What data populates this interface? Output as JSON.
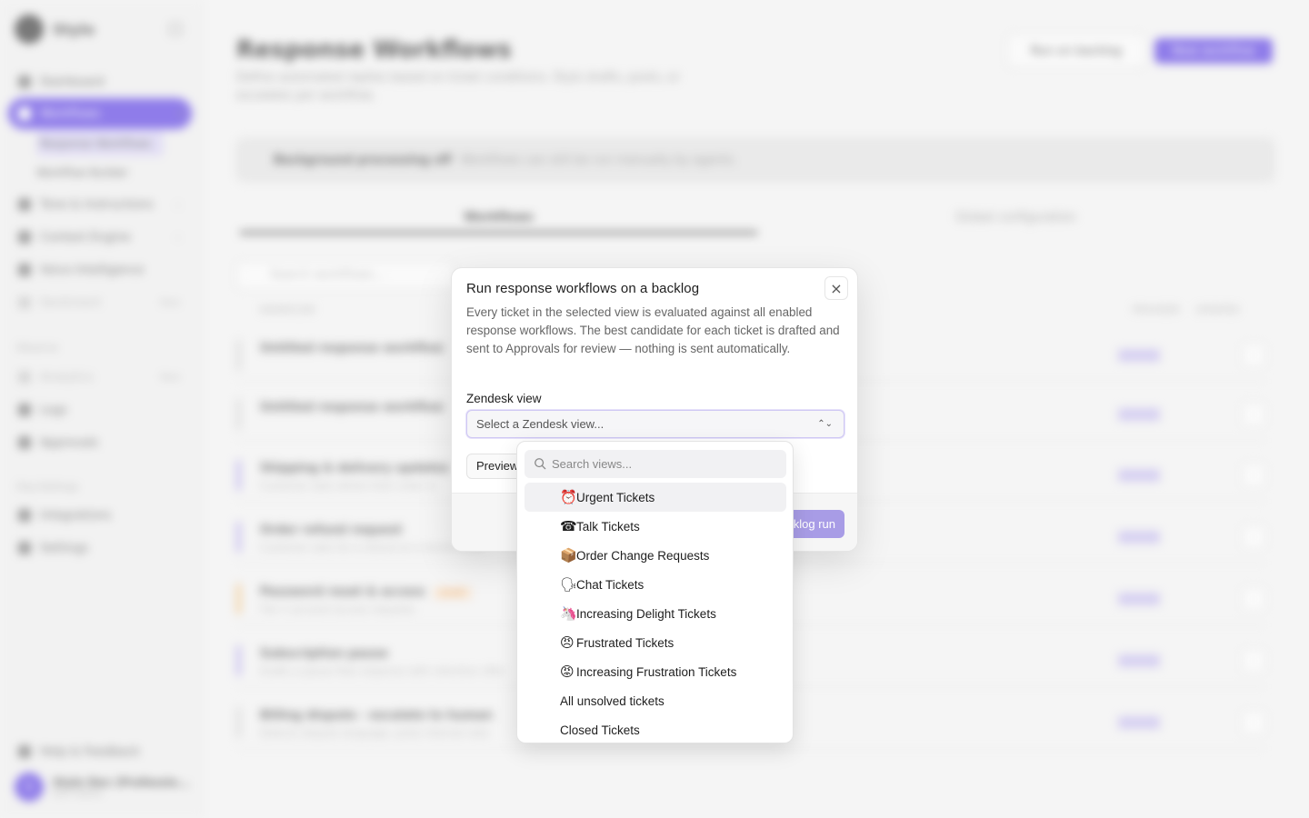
{
  "sidebar": {
    "brand": "Stylo",
    "nav": [
      {
        "label": "Dashboard"
      },
      {
        "label": "Workflows"
      },
      {
        "label": "Response Workflows"
      },
      {
        "label": "Workflow Builder"
      },
      {
        "label": "Tone & Instructions"
      },
      {
        "label": "Context Engine"
      },
      {
        "label": "Voice Intelligence"
      },
      {
        "label": "Sentiment",
        "badge": "New"
      }
    ],
    "observe_label": "Observe",
    "observe": [
      {
        "label": "Analytics",
        "badge": "New"
      },
      {
        "label": "Logs"
      },
      {
        "label": "Approvals"
      }
    ],
    "org_label": "Org Settings",
    "org": [
      {
        "label": "Integrations"
      },
      {
        "label": "Settings"
      }
    ],
    "help": "Help & Feedback",
    "user": {
      "initial": "S",
      "name": "Stylo Dev (Professio...",
      "sub": "Dev Owner"
    }
  },
  "main": {
    "title": "Response Workflows",
    "description": "Define automated replies based on ticket conditions. Stylo drafts, posts, or escalates per workflow.",
    "run_backlog": "Run on backlog",
    "new_workflow": "New workflow",
    "banner_title": "Background processing off",
    "banner_text": "Workflows can still be run manually by agents.",
    "tabs": [
      "Workflows",
      "Global configuration"
    ],
    "search_placeholder": "Search workflows...",
    "columns": [
      "WORKFLOW",
      "PROVIDER",
      "UPDATED"
    ],
    "rows": [
      {
        "title": "Untitled response workflow",
        "sub": "",
        "color": "#d5d5d5"
      },
      {
        "title": "Untitled response workflow",
        "sub": "",
        "color": "#d5d5d5"
      },
      {
        "title": "Shipping & delivery updates",
        "sub": "Customer asks where their order is",
        "color": "#b3a6f0"
      },
      {
        "title": "Order refund request",
        "sub": "Customer asks for a refund on a recent order",
        "color": "#b3a6f0"
      },
      {
        "title": "Password reset & access",
        "sub": "Tier 1 account access requests",
        "color": "#f5c27a",
        "tag": "Draft"
      },
      {
        "title": "Subscription pause",
        "sub": "Drafts a pause flow response with retention offer",
        "color": "#b3a6f0"
      },
      {
        "title": "Billing dispute - escalate to human",
        "sub": "Detects dispute language, posts internal note",
        "color": "#d5d5d5"
      }
    ]
  },
  "modal": {
    "title": "Run response workflows on a backlog",
    "close_icon": "×",
    "description": "Every ticket in the selected view is evaluated against all enabled response workflows. The best candidate for each ticket is drafted and sent to Approvals for review — nothing is sent automatically.",
    "field_label": "Zendesk view",
    "select_placeholder": "Select a Zendesk view...",
    "preview_label": "Preview",
    "start_label": "Start backlog run"
  },
  "dropdown": {
    "search_placeholder": "Search views...",
    "options": [
      {
        "emoji": "⏰",
        "label": "Urgent Tickets"
      },
      {
        "emoji": "☎",
        "label": "Talk Tickets"
      },
      {
        "emoji": "📦",
        "label": "Order Change Requests"
      },
      {
        "emoji": "🗣",
        "label": "Chat Tickets"
      },
      {
        "emoji": "🦄",
        "label": "Increasing Delight Tickets"
      },
      {
        "emoji": "😠",
        "label": "Frustrated Tickets"
      },
      {
        "emoji": "😡",
        "label": "Increasing Frustration Tickets"
      },
      {
        "emoji": "",
        "label": "All unsolved tickets"
      },
      {
        "emoji": "",
        "label": "Closed Tickets"
      }
    ]
  },
  "colors": {
    "accent": "#5b3ee6",
    "accent_soft": "#a89ce6"
  }
}
